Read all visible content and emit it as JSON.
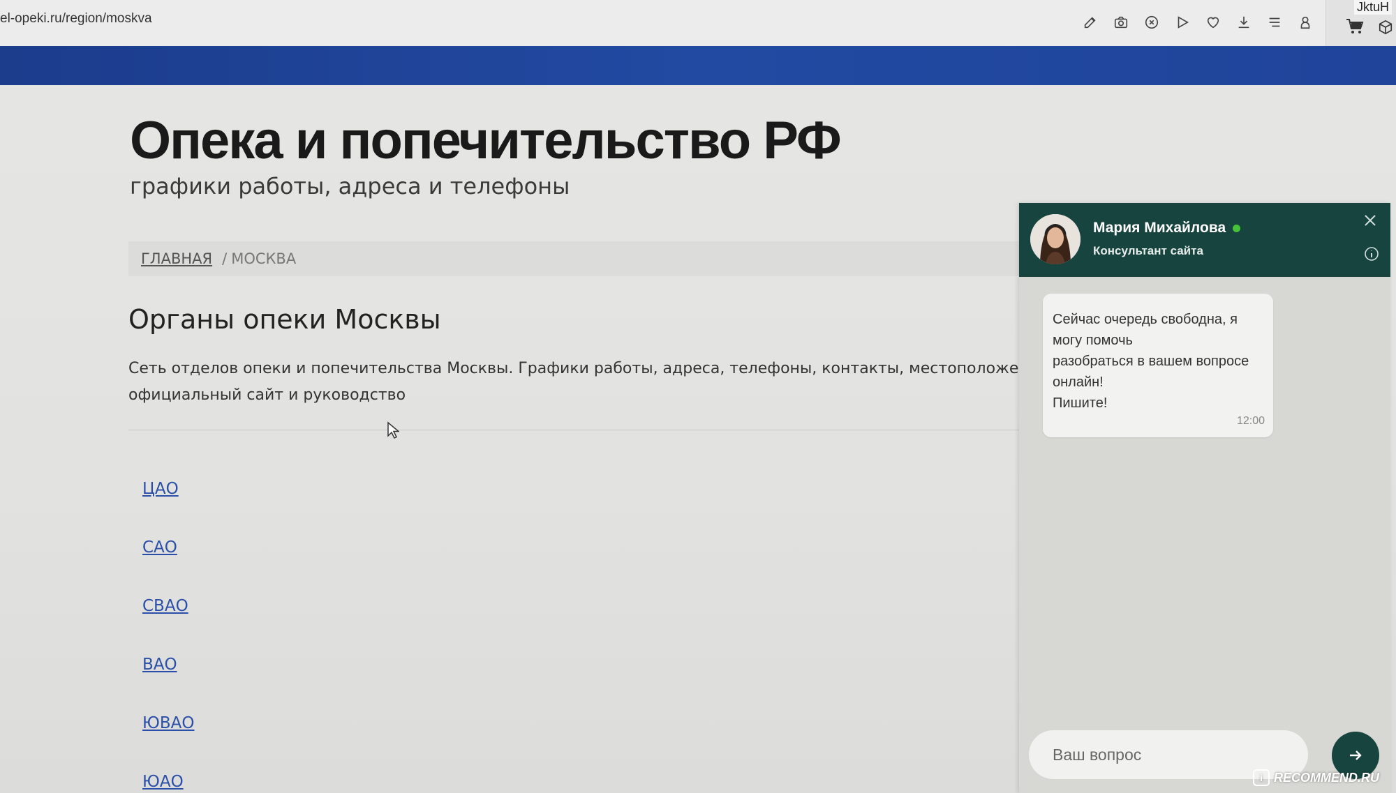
{
  "browser": {
    "url": "el-opeki.ru/region/moskva",
    "extension_label": "JktuH",
    "toolbar_icons": [
      "edit-icon",
      "camera-icon",
      "block-icon",
      "play-icon",
      "heart-icon",
      "download-icon",
      "menu-icon",
      "profile-icon",
      "cart-icon",
      "box-icon"
    ]
  },
  "site": {
    "title": "Опека и попечительство РФ",
    "subtitle": "графики работы, адреса и телефоны",
    "header_color": "#1f449a"
  },
  "breadcrumb": {
    "home": "ГЛАВНАЯ",
    "separator": "/",
    "current": "МОСКВА"
  },
  "content": {
    "section_title": "Органы опеки Москвы",
    "intro_line1": "Сеть отделов опеки и попечительства Москвы. Графики работы, адреса, телефоны, контакты, местоположение на ка",
    "intro_line2": "официальный сайт и руководство",
    "districts": [
      "ЦАО",
      "САО",
      "СВАО",
      "ВАО",
      "ЮВАО",
      "ЮАО"
    ]
  },
  "chat": {
    "agent_name": "Мария Михайлова",
    "agent_role": "Консультант сайта",
    "status": "online",
    "header_color": "#17443f",
    "message": {
      "text_line1": "Сейчас очередь свободна, я могу помочь",
      "text_line2": "разобраться в вашем вопросе онлайн!",
      "text_line3": "Пишите!",
      "time": "12:00"
    },
    "input_placeholder": "Ваш вопрос"
  },
  "watermark": {
    "text": "RECOMMEND.RU"
  }
}
